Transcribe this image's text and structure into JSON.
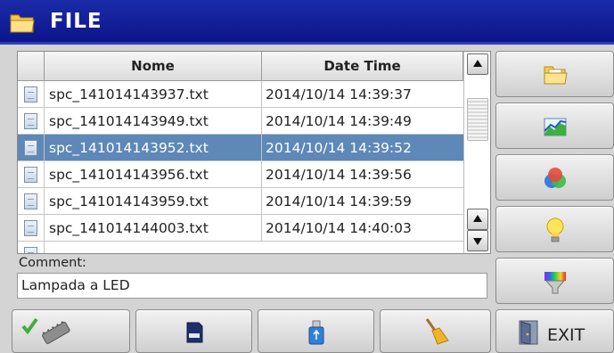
{
  "window": {
    "title": "FILE"
  },
  "table": {
    "columns": [
      "Nome",
      "Date Time"
    ],
    "rows": [
      {
        "name": "spc_141014143937.txt",
        "datetime": "2014/10/14 14:39:37"
      },
      {
        "name": "spc_141014143949.txt",
        "datetime": "2014/10/14 14:39:49"
      },
      {
        "name": "spc_141014143952.txt",
        "datetime": "2014/10/14 14:39:52",
        "selected": true
      },
      {
        "name": "spc_141014143956.txt",
        "datetime": "2014/10/14 14:39:56"
      },
      {
        "name": "spc_141014143959.txt",
        "datetime": "2014/10/14 14:39:59"
      },
      {
        "name": "spc_141014144003.txt",
        "datetime": "2014/10/14 14:40:03"
      }
    ]
  },
  "comment": {
    "label": "Comment:",
    "value": "Lampada a LED"
  },
  "side_buttons": [
    {
      "icon": "folder-icon"
    },
    {
      "icon": "chart-icon"
    },
    {
      "icon": "color-circles-icon"
    },
    {
      "icon": "light-bulb-icon"
    },
    {
      "icon": "spectrum-filter-icon"
    }
  ],
  "bottom_buttons": [
    {
      "icon": "checkmark-chip-icon"
    },
    {
      "icon": "sd-card-icon"
    },
    {
      "icon": "usb-drive-icon"
    },
    {
      "icon": "broom-icon"
    }
  ],
  "exit": {
    "label": "EXIT",
    "icon": "exit-door-icon"
  },
  "colors": {
    "titlebar": "#1b2ba8",
    "selection": "#5d88b8",
    "background": "#d4d4d4"
  }
}
